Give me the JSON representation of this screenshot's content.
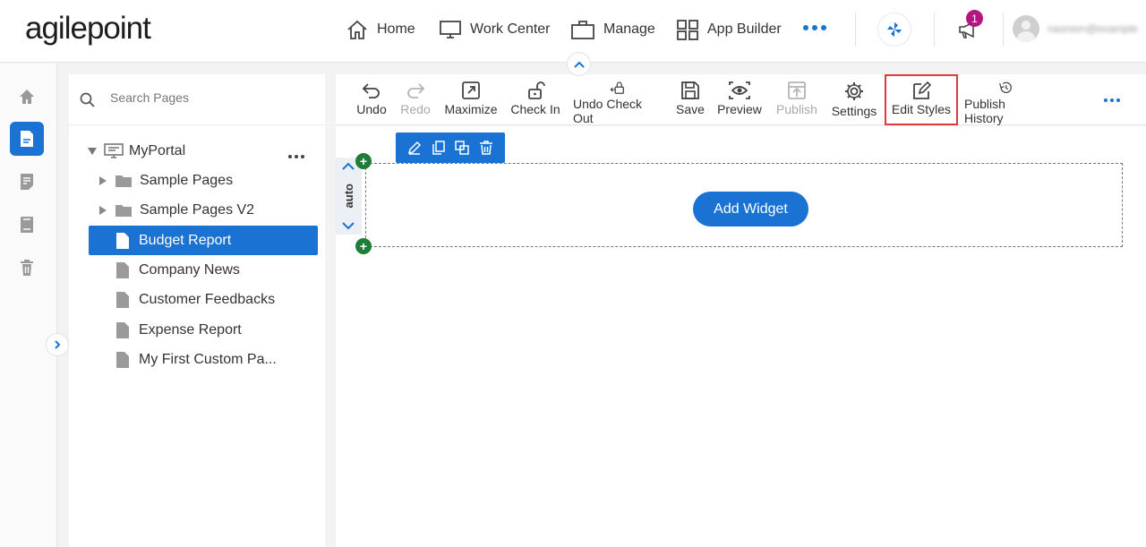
{
  "brand": {
    "logo_text": "agilepoint",
    "accent": "#1a73d2"
  },
  "topnav": {
    "items": [
      {
        "label": "Home",
        "icon": "home-icon"
      },
      {
        "label": "Work Center",
        "icon": "monitor-icon"
      },
      {
        "label": "Manage",
        "icon": "briefcase-icon"
      },
      {
        "label": "App Builder",
        "icon": "grid-icon"
      }
    ],
    "more_icon": "more-horizontal-icon",
    "notification_count": "1",
    "username": "nasreen@example"
  },
  "search": {
    "placeholder": "Search Pages"
  },
  "tree": {
    "root": {
      "label": "MyPortal",
      "icon": "portal-icon"
    },
    "folders": [
      {
        "label": "Sample Pages"
      },
      {
        "label": "Sample Pages V2"
      }
    ],
    "pages": [
      {
        "label": "Budget Report",
        "selected": true
      },
      {
        "label": "Company News"
      },
      {
        "label": "Customer Feedbacks"
      },
      {
        "label": "Expense Report"
      },
      {
        "label": "My First Custom Pa..."
      }
    ]
  },
  "toolbar": {
    "undo": "Undo",
    "redo": "Redo",
    "maximize": "Maximize",
    "check_in": "Check In",
    "undo_check_out": "Undo Check Out",
    "save": "Save",
    "preview": "Preview",
    "publish": "Publish",
    "settings": "Settings",
    "edit_styles": "Edit Styles",
    "publish_history": "Publish History"
  },
  "canvas": {
    "height_mode": "auto",
    "add_widget_label": "Add Widget",
    "row_plus": "+"
  },
  "colors": {
    "highlight_border": "#e03a3a",
    "add_dot": "#1e7d38",
    "badge": "#b3167f"
  }
}
